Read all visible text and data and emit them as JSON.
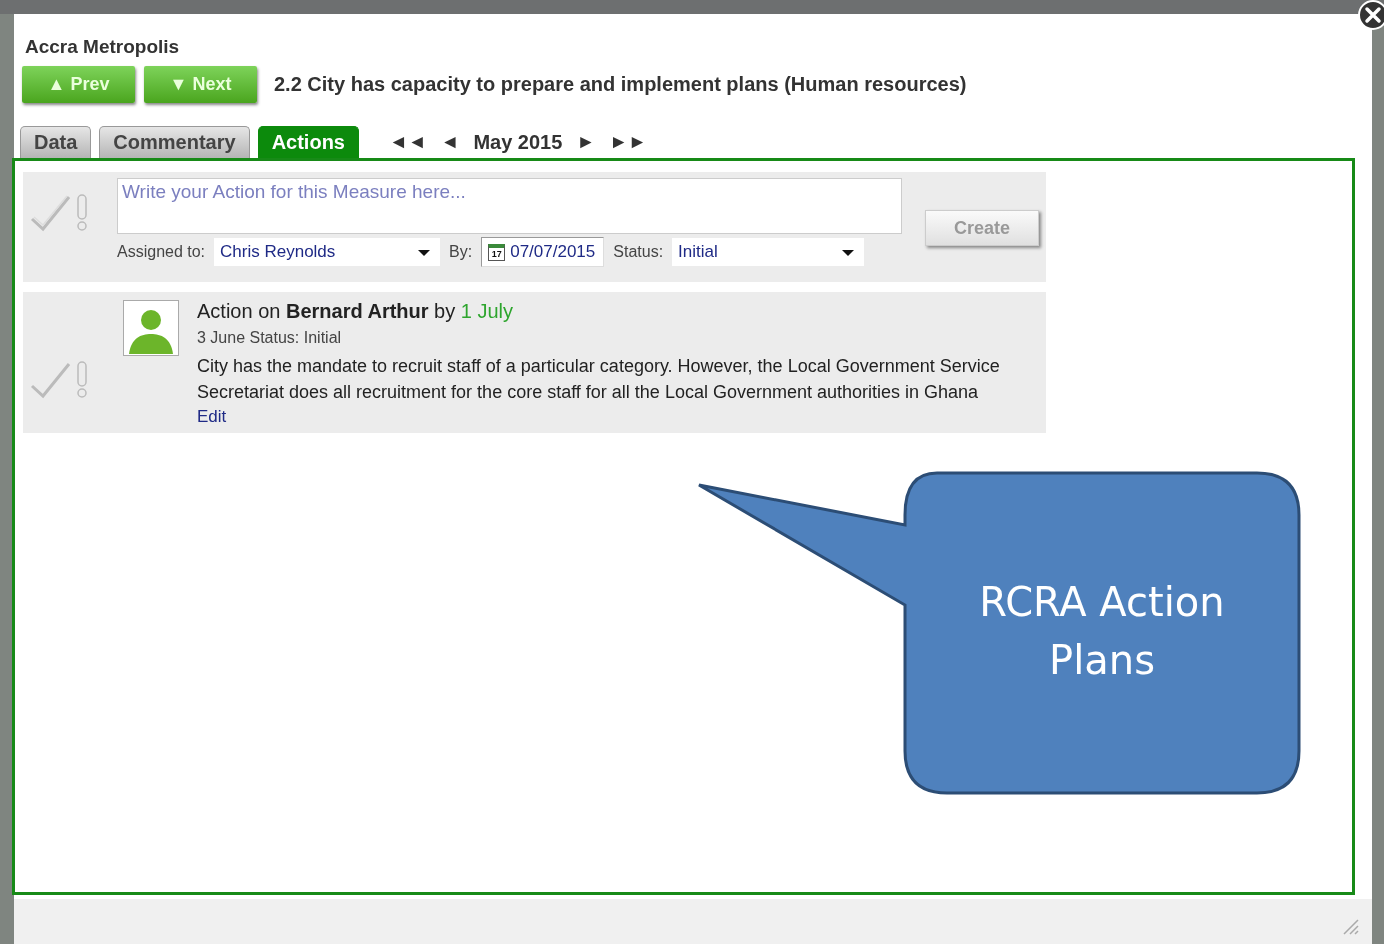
{
  "dialog": {
    "title": "Accra Metropolis",
    "prev_button": "▲ Prev",
    "next_button": "▼ Next",
    "measure": "2.2 City has capacity to prepare and implement plans (Human resources)"
  },
  "tabs": [
    {
      "label": "Data",
      "selected": false
    },
    {
      "label": "Commentary",
      "selected": false
    },
    {
      "label": "Actions",
      "selected": true
    }
  ],
  "period": {
    "first": "◄◄",
    "previous": "◄",
    "label": "May 2015",
    "next": "►",
    "last": "►►"
  },
  "new_action": {
    "placeholder": "Write your Action for this Measure here...",
    "assigned_label": "Assigned to:",
    "assigned_value": "Chris Reynolds",
    "by_label": "By:",
    "date": "07/07/2015",
    "calendar_day": "17",
    "status_label": "Status:",
    "status_value": "Initial",
    "create_button": "Create",
    "disabled": true
  },
  "actions": [
    {
      "heading": "Action on **Bernard Arthur** by",
      "due": "1 July",
      "meta": "3 June Status: Initial",
      "text": "City has the mandate to recruit staff of a particular category. However, the Local Government Service Secretariat does all recruitment for the core staff for all the Local Government authorities in Ghana",
      "edit_link": "Edit",
      "done": false
    }
  ],
  "callout": {
    "text": "RCRA Action Plans"
  }
}
